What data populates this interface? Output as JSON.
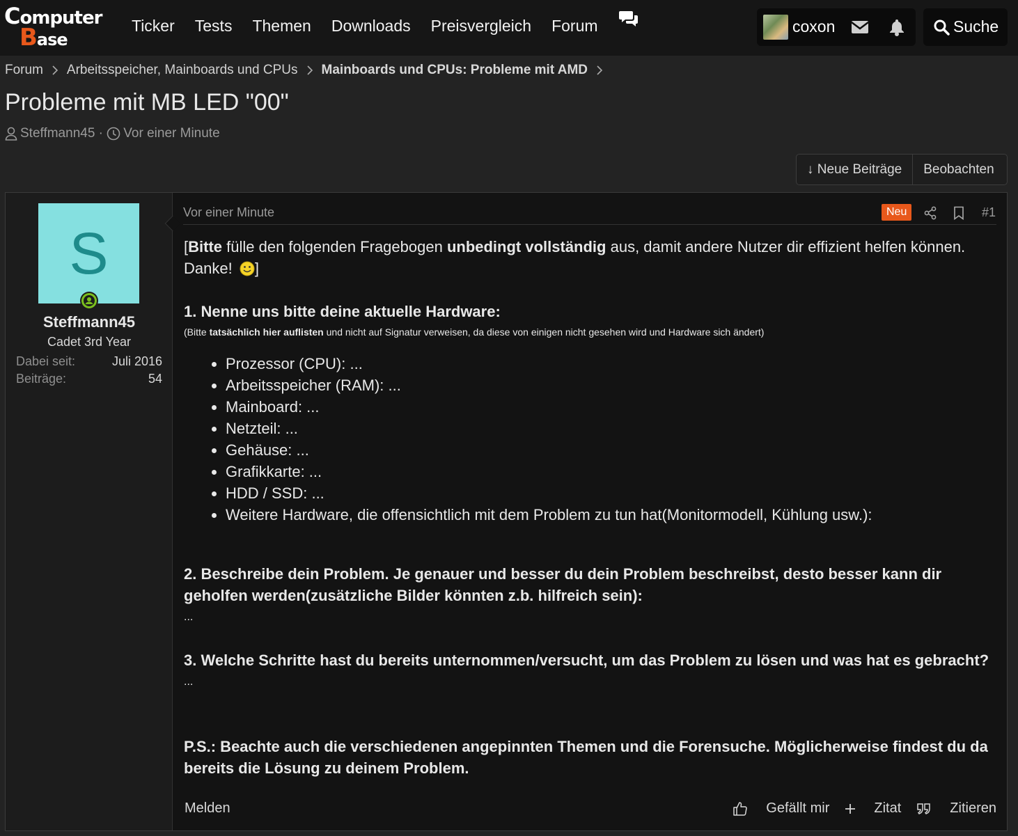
{
  "logo": {
    "line1_big": "C",
    "line1_small": "omputer",
    "line2_big": "B",
    "line2_small": "ase"
  },
  "nav": {
    "items": [
      "Ticker",
      "Tests",
      "Themen",
      "Downloads",
      "Preisvergleich",
      "Forum"
    ]
  },
  "user": {
    "name": "coxon"
  },
  "search": {
    "label": "Suche"
  },
  "breadcrumb": {
    "items": [
      "Forum",
      "Arbeitsspeicher, Mainboards und CPUs",
      "Mainboards und CPUs: Probleme mit AMD"
    ]
  },
  "thread": {
    "title": "Probleme mit MB LED \"00\"",
    "author": "Steffmann45",
    "time": "Vor einer Minute"
  },
  "buttons": {
    "new_posts": "↓ Neue Beiträge",
    "watch": "Beobachten"
  },
  "poster": {
    "avatar_letter": "S",
    "name": "Steffmann45",
    "rank": "Cadet 3rd Year",
    "joined_label": "Dabei seit:",
    "joined_value": "Juli 2016",
    "posts_label": "Beiträge:",
    "posts_value": "54"
  },
  "post": {
    "time": "Vor einer Minute",
    "badge": "Neu",
    "number": "#1",
    "intro": {
      "p1": "[",
      "b1": "Bitte",
      "p2": " fülle den folgenden Fragebogen ",
      "b2": "unbedingt vollständig",
      "p3": " aus, damit andere Nutzer dir effizient helfen können. Danke! ",
      "p4": "]"
    },
    "q1_title": "1. Nenne uns bitte deine aktuelle Hardware:",
    "q1_note": {
      "p1": "(Bitte ",
      "b1": "tatsächlich hier auflisten",
      "p2": " und nicht auf Signatur verweisen, da diese von einigen nicht gesehen wird und Hardware sich ändert)"
    },
    "hardware": [
      "Prozessor (CPU): ...",
      "Arbeitsspeicher (RAM): ...",
      "Mainboard: ...",
      "Netzteil: ...",
      "Gehäuse: ...",
      "Grafikkarte: ...",
      "HDD / SSD: ...",
      "Weitere Hardware, die offensichtlich mit dem Problem zu tun hat(Monitormodell, Kühlung usw.):"
    ],
    "q2_title": "2. Beschreibe dein Problem. Je genauer und besser du dein Problem beschreibst, desto besser kann dir geholfen werden(zusätzliche Bilder könnten z.b. hilfreich sein):",
    "q2_answer": "...",
    "q3_title": "3. Welche Schritte hast du bereits unternommen/versucht, um das Problem zu lösen und was hat es gebracht?",
    "q3_answer": "...",
    "ps": "P.S.: Beachte auch die verschiedenen angepinnten Themen und die Forensuche. Möglicherweise findest du da bereits die Lösung zu deinem Problem."
  },
  "footer": {
    "report": "Melden",
    "like": "Gefällt mir",
    "quote": "Zitat",
    "reply": "Zitieren"
  }
}
